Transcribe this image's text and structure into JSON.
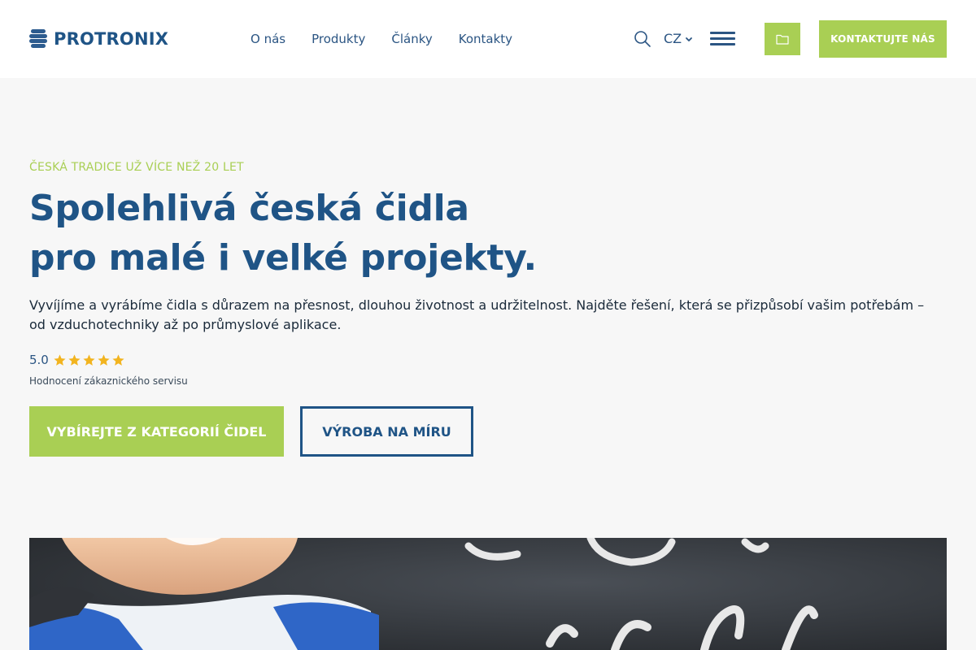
{
  "header": {
    "brand": "PROTRONIX",
    "nav": [
      "O nás",
      "Produkty",
      "Články",
      "Kontakty"
    ],
    "language": "CZ",
    "contact_button": "KONTAKTUJTE NÁS",
    "icons": {
      "search": "search-icon",
      "language_chevron": "chevron-down-icon",
      "menu": "hamburger-menu-icon",
      "folder": "folder-icon"
    }
  },
  "hero": {
    "eyebrow": "ČESKÁ TRADICE UŽ VÍCE NEŽ 20 LET",
    "headline_line1": "Spolehlivá česká čidla",
    "headline_line2": "pro malé i velké projekty.",
    "lead": "Vyvíjíme a vyrábíme čidla s důrazem na přesnost, dlouhou životnost a udržitelnost. Najděte řešení, která se přizpůsobí vašim potřebám – od vzduchotechniky až po průmyslové aplikace.",
    "rating_value": "5.0",
    "rating_stars": 5,
    "rating_caption": "Hodnocení zákaznického servisu",
    "primary_button": "VYBÍREJTE Z KATEGORIÍ ČIDEL",
    "secondary_button": "VÝROBA NA MÍRU"
  },
  "colors": {
    "brand_blue": "#1f5486",
    "accent_green": "#a9cf54",
    "background": "#f7f7f7",
    "star_gold": "#f2b41f"
  }
}
